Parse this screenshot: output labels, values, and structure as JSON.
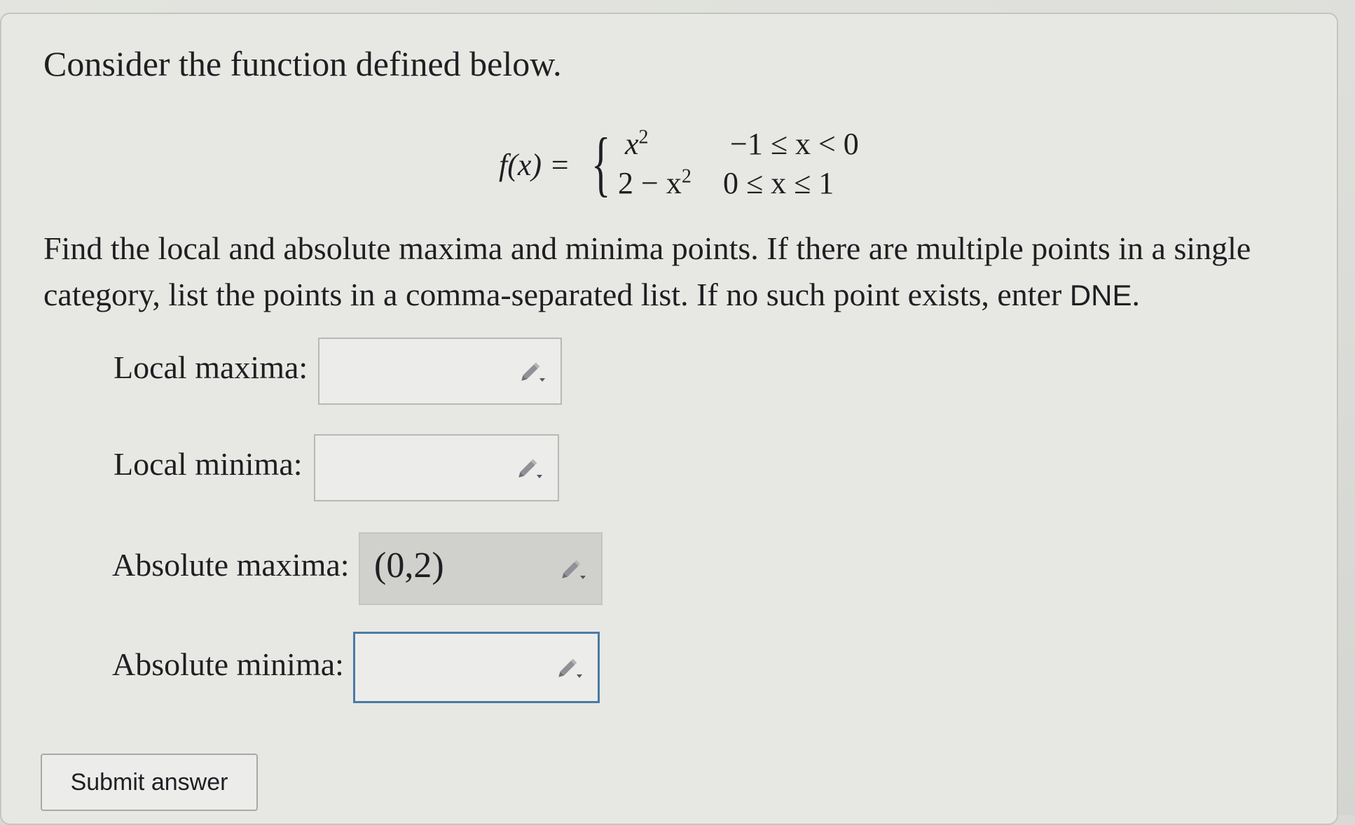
{
  "question": {
    "intro": "Consider the function defined below.",
    "formula": {
      "lhs": "f(x) =",
      "piece1_expr": "x",
      "piece1_exp": "2",
      "piece1_cond": "−1 ≤ x < 0",
      "piece2_expr": "2 − x",
      "piece2_exp": "2",
      "piece2_cond": "0 ≤ x ≤ 1"
    },
    "instructions": "Find the local and absolute maxima and minima points. If there are multiple points in a single category, list the points in a comma-separated list. If no such point exists, enter",
    "dne": "DNE",
    "dne_trailing": "."
  },
  "fields": [
    {
      "label": "Local maxima:",
      "value": ""
    },
    {
      "label": "Local minima:",
      "value": ""
    },
    {
      "label": "Absolute maxima:",
      "value": "(0,2)"
    },
    {
      "label": "Absolute minima:",
      "value": ""
    }
  ],
  "submit_label": "Submit answer",
  "icons": {
    "field_icon": "pencil-icon"
  },
  "colors": {
    "focus_border": "#4a7aa6",
    "filled_background": "#d0d1cd"
  }
}
